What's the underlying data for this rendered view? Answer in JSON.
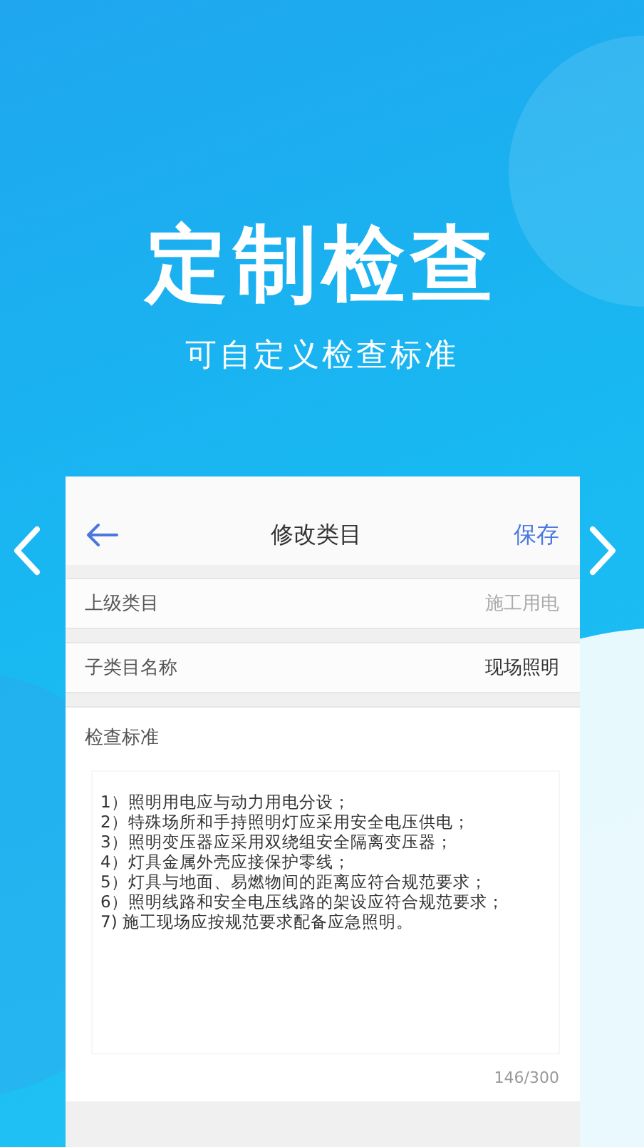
{
  "headline": "定制检查",
  "subtitle": "可自定义检查标准",
  "nav": {
    "title": "修改类目",
    "action": "保存"
  },
  "rows": [
    {
      "label": "上级类目",
      "value": "施工用电",
      "disabled": true
    },
    {
      "label": "子类目名称",
      "value": "现场照明",
      "disabled": false
    }
  ],
  "standard": {
    "label": "检查标准",
    "value": "1）照明用电应与动力用电分设；\n2）特殊场所和手持照明灯应采用安全电压供电；\n3）照明变压器应采用双绕组安全隔离变压器；\n4）灯具金属外壳应接保护零线；\n5）灯具与地面、易燃物间的距离应符合规范要求；\n6）照明线路和安全电压线路的架设应符合规范要求；\n7) 施工现场应按规范要求配备应急照明。",
    "counter": "146/300"
  }
}
